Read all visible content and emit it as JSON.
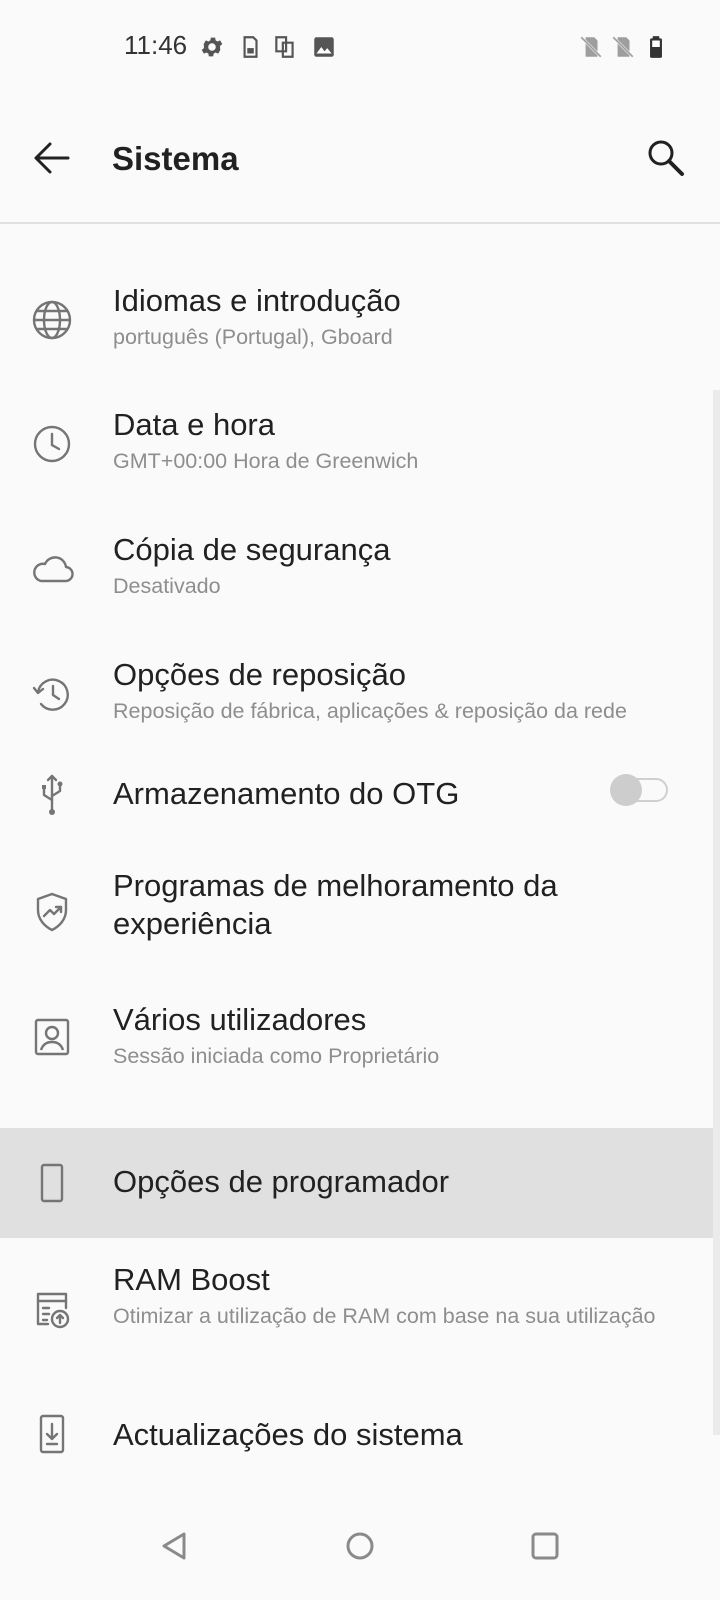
{
  "status_bar": {
    "time": "11:46",
    "left_icons": [
      "gear-icon",
      "sim-card-icon",
      "copy-icon",
      "image-icon"
    ],
    "right_icons": [
      "no-sim-icon",
      "no-sim-icon",
      "battery-icon"
    ]
  },
  "header": {
    "title": "Sistema"
  },
  "settings": [
    {
      "icon": "globe-icon",
      "title": "Idiomas e introdução",
      "subtitle": "português (Portugal), Gboard"
    },
    {
      "icon": "clock-icon",
      "title": "Data e hora",
      "subtitle": "GMT+00:00 Hora de Greenwich"
    },
    {
      "icon": "cloud-icon",
      "title": "Cópia de segurança",
      "subtitle": "Desativado"
    },
    {
      "icon": "history-icon",
      "title": "Opções de reposição",
      "subtitle": "Reposição de fábrica, aplicações & reposição da rede"
    },
    {
      "icon": "usb-icon",
      "title": "Armazenamento do OTG",
      "toggle_on": false
    },
    {
      "icon": "shield-trend-icon",
      "title": "Programas de melhoramento da experiência"
    },
    {
      "icon": "user-icon",
      "title": "Vários utilizadores",
      "subtitle": "Sessão iniciada como Proprietário"
    },
    {
      "icon": "phone-icon",
      "title": "Opções de programador",
      "highlighted": true
    },
    {
      "icon": "ram-boost-icon",
      "title": "RAM Boost",
      "subtitle": "Otimizar a utilização de RAM com base na sua utilização"
    },
    {
      "icon": "system-update-icon",
      "title": "Actualizações do sistema"
    }
  ],
  "nav_bar": {
    "buttons": [
      "back-triangle-icon",
      "home-circle-icon",
      "recents-square-icon"
    ]
  },
  "colors": {
    "background": "#FAFAFA",
    "highlight": "#E0E0E0",
    "title_text": "#212121",
    "subtitle_text": "#8E8E8E",
    "icon": "#757575"
  }
}
